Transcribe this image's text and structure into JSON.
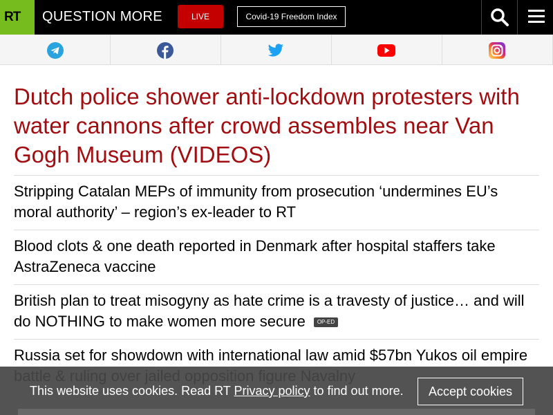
{
  "header": {
    "logo": "RT",
    "brand": "QUESTION MORE",
    "live_label": "LIVE",
    "covid_label": "Covid-19 Freedom Index",
    "search_icon": "search-icon",
    "menu_icon": "menu-icon"
  },
  "social": [
    {
      "name": "telegram",
      "icon": "telegram-icon",
      "color": "#2aa3df"
    },
    {
      "name": "facebook",
      "icon": "facebook-icon",
      "color": "#3b5998"
    },
    {
      "name": "twitter",
      "icon": "twitter-icon",
      "color": "#1da1f2"
    },
    {
      "name": "youtube",
      "icon": "youtube-icon",
      "color": "#ff0000"
    },
    {
      "name": "instagram",
      "icon": "instagram-icon",
      "color": "#e1306c"
    }
  ],
  "main": {
    "headline": "Dutch police shower anti-lockdown protesters with water cannons after crowd assembles near Van Gogh Museum (VIDEOS)",
    "stories": [
      {
        "title": "Stripping Catalan MEPs of immunity from prosecution ‘undermines EU’s moral authority’ – region’s ex-leader to RT",
        "badge": ""
      },
      {
        "title": "Blood clots & one death reported in Denmark after hospital staffers take AstraZeneca vaccine",
        "badge": ""
      },
      {
        "title": "British plan to treat misogyny as hate crime is a travesty of justice… and will do NOTHING to make women more secure",
        "badge": "OP-ED"
      },
      {
        "title": "Russia set for showdown with international law amid $57bn Yukos oil empire battle & ruling over jailed opposition figure Navalny",
        "badge": ""
      }
    ]
  },
  "cookie": {
    "text_before": "This website uses cookies. Read RT ",
    "link": "Privacy policy",
    "text_after": " to find out more.",
    "accept": "Accept cookies"
  },
  "colors": {
    "accent": "#77bc1f",
    "headline": "#a10d10",
    "live": "#c40000"
  }
}
